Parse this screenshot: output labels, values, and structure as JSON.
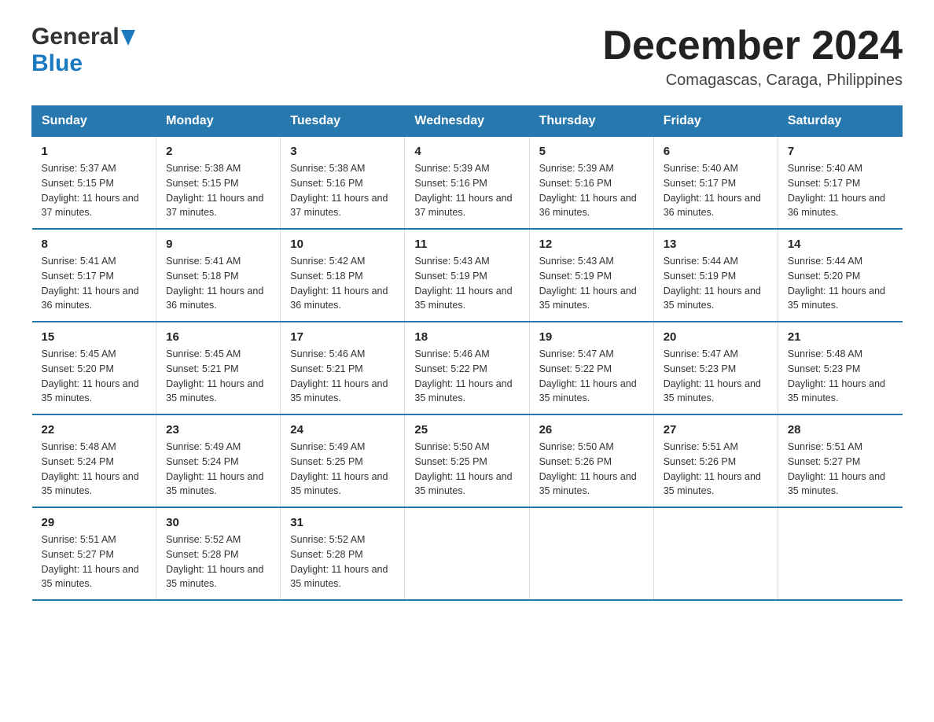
{
  "header": {
    "logo": {
      "general": "General",
      "blue": "Blue",
      "triangle_color": "#1a7abf"
    },
    "title": "December 2024",
    "subtitle": "Comagascas, Caraga, Philippines"
  },
  "calendar": {
    "days_of_week": [
      "Sunday",
      "Monday",
      "Tuesday",
      "Wednesday",
      "Thursday",
      "Friday",
      "Saturday"
    ],
    "header_bg": "#2878b0",
    "weeks": [
      [
        {
          "day": "1",
          "sunrise": "Sunrise: 5:37 AM",
          "sunset": "Sunset: 5:15 PM",
          "daylight": "Daylight: 11 hours and 37 minutes."
        },
        {
          "day": "2",
          "sunrise": "Sunrise: 5:38 AM",
          "sunset": "Sunset: 5:15 PM",
          "daylight": "Daylight: 11 hours and 37 minutes."
        },
        {
          "day": "3",
          "sunrise": "Sunrise: 5:38 AM",
          "sunset": "Sunset: 5:16 PM",
          "daylight": "Daylight: 11 hours and 37 minutes."
        },
        {
          "day": "4",
          "sunrise": "Sunrise: 5:39 AM",
          "sunset": "Sunset: 5:16 PM",
          "daylight": "Daylight: 11 hours and 37 minutes."
        },
        {
          "day": "5",
          "sunrise": "Sunrise: 5:39 AM",
          "sunset": "Sunset: 5:16 PM",
          "daylight": "Daylight: 11 hours and 36 minutes."
        },
        {
          "day": "6",
          "sunrise": "Sunrise: 5:40 AM",
          "sunset": "Sunset: 5:17 PM",
          "daylight": "Daylight: 11 hours and 36 minutes."
        },
        {
          "day": "7",
          "sunrise": "Sunrise: 5:40 AM",
          "sunset": "Sunset: 5:17 PM",
          "daylight": "Daylight: 11 hours and 36 minutes."
        }
      ],
      [
        {
          "day": "8",
          "sunrise": "Sunrise: 5:41 AM",
          "sunset": "Sunset: 5:17 PM",
          "daylight": "Daylight: 11 hours and 36 minutes."
        },
        {
          "day": "9",
          "sunrise": "Sunrise: 5:41 AM",
          "sunset": "Sunset: 5:18 PM",
          "daylight": "Daylight: 11 hours and 36 minutes."
        },
        {
          "day": "10",
          "sunrise": "Sunrise: 5:42 AM",
          "sunset": "Sunset: 5:18 PM",
          "daylight": "Daylight: 11 hours and 36 minutes."
        },
        {
          "day": "11",
          "sunrise": "Sunrise: 5:43 AM",
          "sunset": "Sunset: 5:19 PM",
          "daylight": "Daylight: 11 hours and 35 minutes."
        },
        {
          "day": "12",
          "sunrise": "Sunrise: 5:43 AM",
          "sunset": "Sunset: 5:19 PM",
          "daylight": "Daylight: 11 hours and 35 minutes."
        },
        {
          "day": "13",
          "sunrise": "Sunrise: 5:44 AM",
          "sunset": "Sunset: 5:19 PM",
          "daylight": "Daylight: 11 hours and 35 minutes."
        },
        {
          "day": "14",
          "sunrise": "Sunrise: 5:44 AM",
          "sunset": "Sunset: 5:20 PM",
          "daylight": "Daylight: 11 hours and 35 minutes."
        }
      ],
      [
        {
          "day": "15",
          "sunrise": "Sunrise: 5:45 AM",
          "sunset": "Sunset: 5:20 PM",
          "daylight": "Daylight: 11 hours and 35 minutes."
        },
        {
          "day": "16",
          "sunrise": "Sunrise: 5:45 AM",
          "sunset": "Sunset: 5:21 PM",
          "daylight": "Daylight: 11 hours and 35 minutes."
        },
        {
          "day": "17",
          "sunrise": "Sunrise: 5:46 AM",
          "sunset": "Sunset: 5:21 PM",
          "daylight": "Daylight: 11 hours and 35 minutes."
        },
        {
          "day": "18",
          "sunrise": "Sunrise: 5:46 AM",
          "sunset": "Sunset: 5:22 PM",
          "daylight": "Daylight: 11 hours and 35 minutes."
        },
        {
          "day": "19",
          "sunrise": "Sunrise: 5:47 AM",
          "sunset": "Sunset: 5:22 PM",
          "daylight": "Daylight: 11 hours and 35 minutes."
        },
        {
          "day": "20",
          "sunrise": "Sunrise: 5:47 AM",
          "sunset": "Sunset: 5:23 PM",
          "daylight": "Daylight: 11 hours and 35 minutes."
        },
        {
          "day": "21",
          "sunrise": "Sunrise: 5:48 AM",
          "sunset": "Sunset: 5:23 PM",
          "daylight": "Daylight: 11 hours and 35 minutes."
        }
      ],
      [
        {
          "day": "22",
          "sunrise": "Sunrise: 5:48 AM",
          "sunset": "Sunset: 5:24 PM",
          "daylight": "Daylight: 11 hours and 35 minutes."
        },
        {
          "day": "23",
          "sunrise": "Sunrise: 5:49 AM",
          "sunset": "Sunset: 5:24 PM",
          "daylight": "Daylight: 11 hours and 35 minutes."
        },
        {
          "day": "24",
          "sunrise": "Sunrise: 5:49 AM",
          "sunset": "Sunset: 5:25 PM",
          "daylight": "Daylight: 11 hours and 35 minutes."
        },
        {
          "day": "25",
          "sunrise": "Sunrise: 5:50 AM",
          "sunset": "Sunset: 5:25 PM",
          "daylight": "Daylight: 11 hours and 35 minutes."
        },
        {
          "day": "26",
          "sunrise": "Sunrise: 5:50 AM",
          "sunset": "Sunset: 5:26 PM",
          "daylight": "Daylight: 11 hours and 35 minutes."
        },
        {
          "day": "27",
          "sunrise": "Sunrise: 5:51 AM",
          "sunset": "Sunset: 5:26 PM",
          "daylight": "Daylight: 11 hours and 35 minutes."
        },
        {
          "day": "28",
          "sunrise": "Sunrise: 5:51 AM",
          "sunset": "Sunset: 5:27 PM",
          "daylight": "Daylight: 11 hours and 35 minutes."
        }
      ],
      [
        {
          "day": "29",
          "sunrise": "Sunrise: 5:51 AM",
          "sunset": "Sunset: 5:27 PM",
          "daylight": "Daylight: 11 hours and 35 minutes."
        },
        {
          "day": "30",
          "sunrise": "Sunrise: 5:52 AM",
          "sunset": "Sunset: 5:28 PM",
          "daylight": "Daylight: 11 hours and 35 minutes."
        },
        {
          "day": "31",
          "sunrise": "Sunrise: 5:52 AM",
          "sunset": "Sunset: 5:28 PM",
          "daylight": "Daylight: 11 hours and 35 minutes."
        },
        null,
        null,
        null,
        null
      ]
    ]
  }
}
